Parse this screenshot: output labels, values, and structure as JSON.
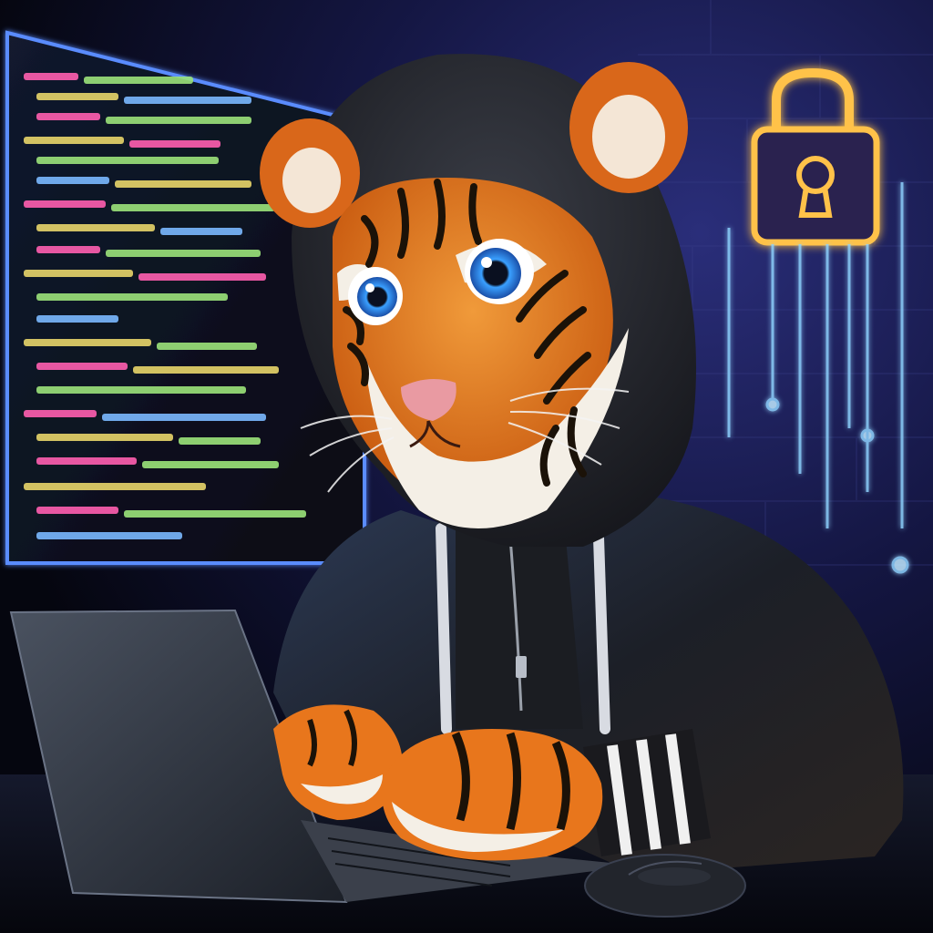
{
  "scene": {
    "subject": "tiger-hacker",
    "palette": {
      "background": "#0a0b1e",
      "wall_glow": "#1a1f5a",
      "screen_border": "#5a8cff",
      "code_pink": "#ff5fb0",
      "code_green": "#9be37a",
      "code_yellow": "#e8d56a",
      "code_blue": "#7ab8ff",
      "neon_lock": "#ffc24a",
      "neon_lines": "#8fd3ff",
      "hoodie": "#2a2c33",
      "tiger_orange": "#e8761c",
      "tiger_stripe": "#1b1208",
      "tiger_white": "#f4efe6",
      "eye": "#2f8cff",
      "laptop": "#3a3f4a",
      "desk": "#0c0f1c",
      "mouse": "#22252c"
    },
    "icons": {
      "lock": "padlock-icon",
      "keyhole": "keyhole-icon"
    }
  }
}
